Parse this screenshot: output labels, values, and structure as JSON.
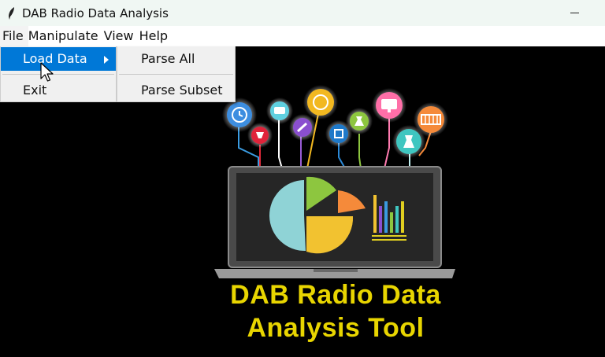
{
  "window": {
    "title": "DAB Radio Data Analysis"
  },
  "menubar": {
    "items": [
      "File",
      "Manipulate",
      "View",
      "Help"
    ]
  },
  "file_menu": {
    "items": [
      "Load Data",
      "Exit"
    ],
    "active": "Load Data"
  },
  "load_submenu": {
    "items": [
      "Parse All",
      "Parse Subset"
    ]
  },
  "caption": {
    "line1": "DAB Radio Data",
    "line2": "Analysis Tool"
  },
  "colors": {
    "caption": "#e8d500",
    "menu_highlight": "#0078d7",
    "background": "#000000"
  },
  "logo": {
    "icons": [
      "clock-icon",
      "chat-icon",
      "globe-icon",
      "monitor-icon",
      "lightbulb-icon",
      "pencil-icon",
      "square-icon",
      "flask-icon",
      "calendar-icon",
      "beaker-icon"
    ],
    "screen_chart": "pie-and-bar-chart"
  }
}
